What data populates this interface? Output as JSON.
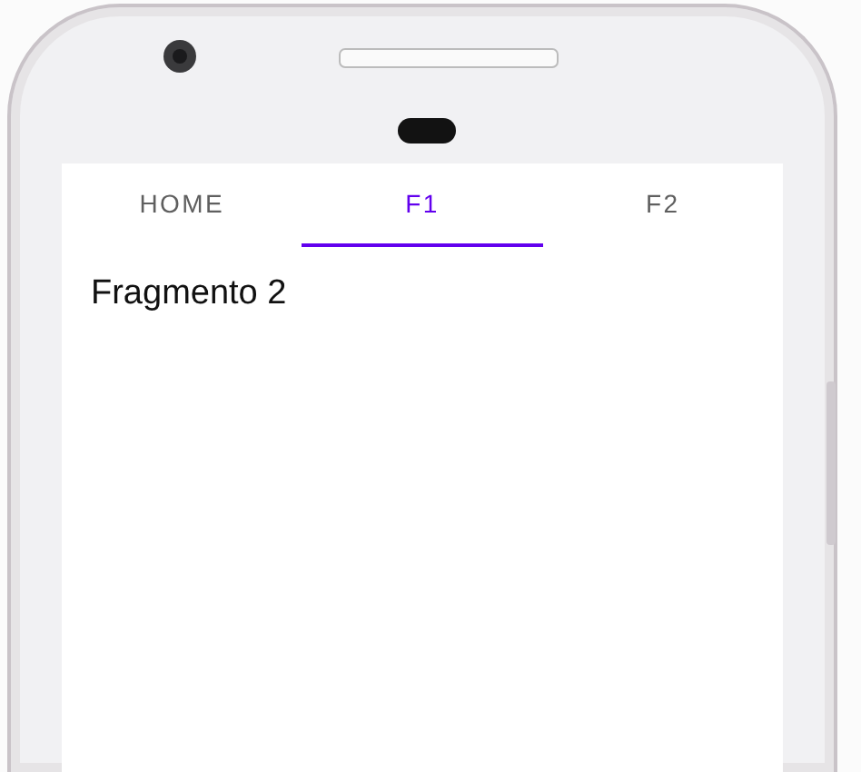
{
  "tabs": [
    {
      "label": "HOME",
      "selected": false
    },
    {
      "label": "F1",
      "selected": true
    },
    {
      "label": "F2",
      "selected": false
    }
  ],
  "content": {
    "text": "Fragmento 2"
  }
}
